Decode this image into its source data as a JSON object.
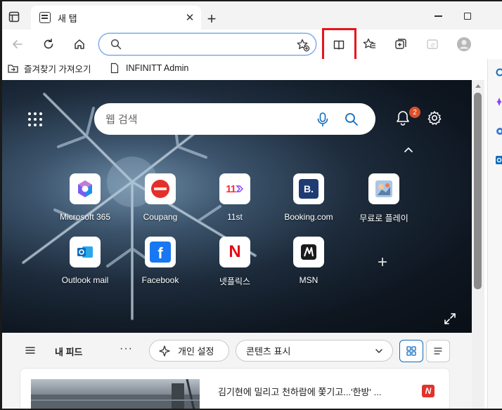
{
  "tab": {
    "title": "새 탭",
    "close": "✕",
    "new_tab": "+"
  },
  "address_bar": {
    "value": "",
    "placeholder": ""
  },
  "favorites_bar": {
    "items": [
      {
        "label": "즐겨찾기 가져오기"
      },
      {
        "label": "INFINITT Admin"
      }
    ]
  },
  "ntp": {
    "search_placeholder": "웹 검색",
    "notification_count": "2",
    "tiles": [
      {
        "label": "Microsoft 365",
        "icon": "microsoft-365-icon"
      },
      {
        "label": "Coupang",
        "icon": "coupang-icon"
      },
      {
        "label": "11st",
        "icon": "11st-icon",
        "icon_text": "11"
      },
      {
        "label": "Booking.com",
        "icon": "booking-icon",
        "icon_text": "B."
      },
      {
        "label": "무료로 플레이",
        "icon": "game-icon"
      },
      {
        "label": "Outlook mail",
        "icon": "outlook-icon"
      },
      {
        "label": "Facebook",
        "icon": "facebook-icon",
        "icon_text": "f"
      },
      {
        "label": "넷플릭스",
        "icon": "netflix-icon",
        "icon_text": "N"
      },
      {
        "label": "MSN",
        "icon": "msn-icon"
      }
    ],
    "add_tile": "+"
  },
  "feed": {
    "title": "내 피드",
    "more": "···",
    "personalize_label": "개인 설정",
    "content_display_label": "콘텐츠 표시",
    "article_headline": "김기현에 밀리고 천하람에 쫓기고...'한방' ...",
    "article_source_logo": "N"
  },
  "colors": {
    "accent_blue": "#0f6cbd",
    "highlight_red": "#e8131c",
    "notification_badge": "#d9502a"
  }
}
